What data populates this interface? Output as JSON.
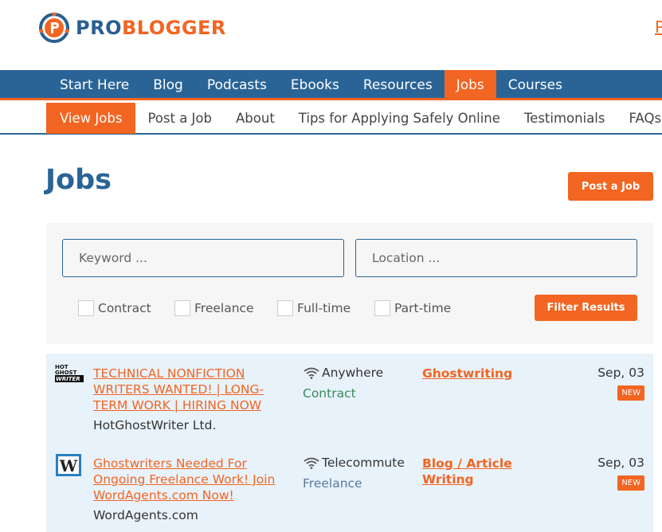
{
  "header": {
    "logo_pro": "PRO",
    "logo_blogger": "BLOGGER",
    "top_link": "P"
  },
  "nav_main": [
    "Start Here",
    "Blog",
    "Podcasts",
    "Ebooks",
    "Resources",
    "Jobs",
    "Courses"
  ],
  "nav_sub": [
    "View Jobs",
    "Post a Job",
    "About",
    "Tips for Applying Safely Online",
    "Testimonials",
    "FAQs"
  ],
  "page": {
    "title": "Jobs",
    "post_job_label": "Post a Job"
  },
  "filters": {
    "keyword_placeholder": "Keyword ...",
    "location_placeholder": "Location ...",
    "checkboxes": [
      "Contract",
      "Freelance",
      "Full-time",
      "Part-time"
    ],
    "submit_label": "Filter Results"
  },
  "jobs": [
    {
      "logo_text": "HOT GHOST WRITER",
      "title": "TECHNICAL NONFICTION WRITERS WANTED! | LONG-TERM WORK | HIRING NOW",
      "company": "HotGhostWriter Ltd.",
      "location": "Anywhere",
      "type": "Contract",
      "type_color": "#3a8a5a",
      "category": "Ghostwriting",
      "date": "Sep, 03",
      "badge": "NEW"
    },
    {
      "logo_text": "W",
      "title": "Ghostwriters Needed For Ongoing Freelance Work! Join WordAgents.com Now!",
      "company": "WordAgents.com",
      "location": "Telecommute",
      "type": "Freelance",
      "type_color": "#5a7a9a",
      "category": "Blog / Article Writing",
      "date": "Sep, 03",
      "badge": "NEW"
    }
  ],
  "colors": {
    "brand_blue": "#2a6496",
    "accent_orange": "#f26522",
    "row_bg": "#e8f2fb"
  }
}
